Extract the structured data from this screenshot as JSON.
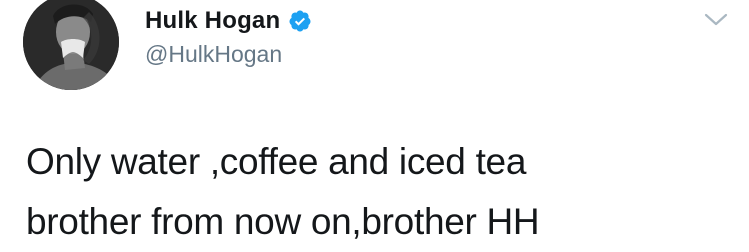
{
  "profile": {
    "display_name": "Hulk Hogan",
    "handle": "@HulkHogan",
    "verified": true,
    "avatar_icon": "profile-photo"
  },
  "tweet": {
    "lines": [
      "Only water ,coffee and iced tea",
      "brother from now on,brother HH"
    ]
  },
  "icons": {
    "verified": "verified-badge-icon",
    "menu": "chevron-down-icon"
  },
  "colors": {
    "verified_blue": "#1da1f2",
    "handle_gray": "#657786",
    "text": "#14171a",
    "chevron_gray": "#aab8c2"
  }
}
